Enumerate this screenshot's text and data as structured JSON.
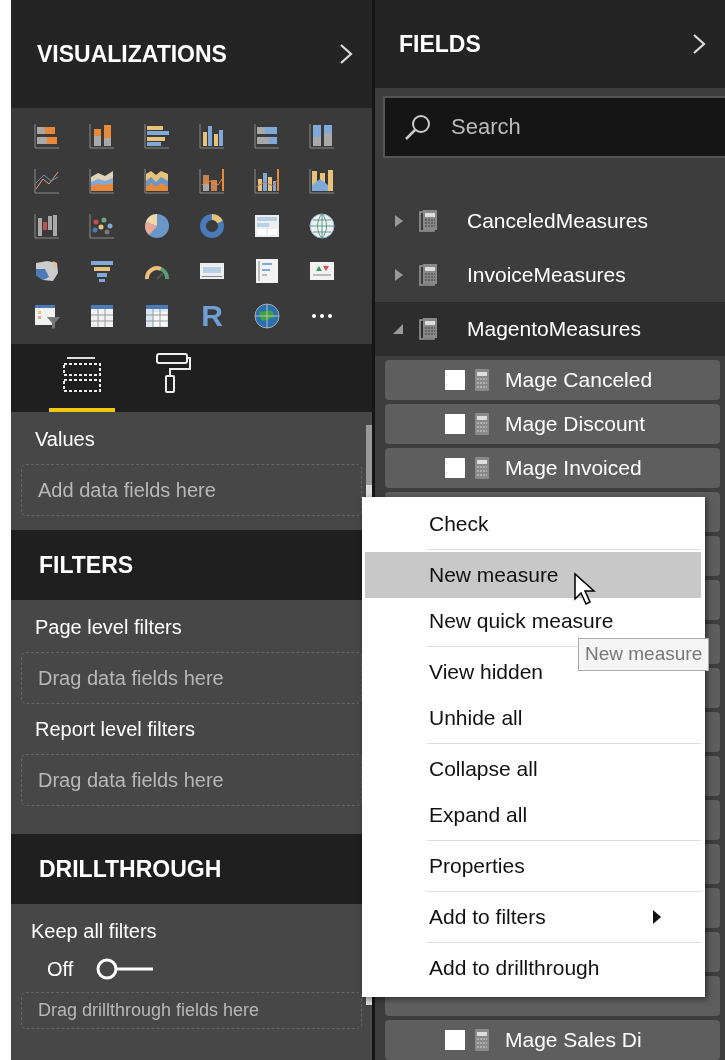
{
  "visualizations": {
    "title": "VISUALIZATIONS",
    "r_label": "R",
    "tabs": [
      {
        "kind": "fields",
        "selected": true
      },
      {
        "kind": "format",
        "selected": false
      }
    ],
    "values": {
      "label": "Values",
      "placeholder": "Add data fields here"
    }
  },
  "filters": {
    "title": "FILTERS",
    "sections": [
      {
        "label": "Page level filters",
        "placeholder": "Drag data fields here"
      },
      {
        "label": "Report level filters",
        "placeholder": "Drag data fields here"
      }
    ]
  },
  "drillthrough": {
    "title": "DRILLTHROUGH",
    "toggle_label": "Keep all filters",
    "toggle_state": "Off",
    "on": false,
    "placeholder": "Drag drillthrough fields here"
  },
  "fields": {
    "title": "FIELDS",
    "search": {
      "placeholder": "Search"
    },
    "tables": [
      {
        "name": "CanceledMeasures",
        "expanded": false
      },
      {
        "name": "InvoiceMeasures",
        "expanded": false
      },
      {
        "name": "MagentoMeasures",
        "expanded": true,
        "children": [
          {
            "name": "Mage Canceled",
            "checked": false
          },
          {
            "name": "Mage Discount",
            "checked": false
          },
          {
            "name": "Mage Invoiced",
            "checked": false
          },
          {
            "name": "Mage Sales Di",
            "checked": false
          }
        ]
      }
    ]
  },
  "context_menu": {
    "groups": [
      [
        {
          "label": "Check",
          "selected": false,
          "submenu": false
        }
      ],
      [
        {
          "label": "New measure",
          "selected": true,
          "submenu": false
        },
        {
          "label": "New quick measure",
          "selected": false,
          "submenu": false
        }
      ],
      [
        {
          "label": "View hidden",
          "selected": false,
          "submenu": false
        },
        {
          "label": "Unhide all",
          "selected": false,
          "submenu": false
        }
      ],
      [
        {
          "label": "Collapse all",
          "selected": false,
          "submenu": false
        },
        {
          "label": "Expand all",
          "selected": false,
          "submenu": false
        }
      ],
      [
        {
          "label": "Properties",
          "selected": false,
          "submenu": false
        }
      ],
      [
        {
          "label": "Add to filters",
          "selected": false,
          "submenu": true
        }
      ],
      [
        {
          "label": "Add to drillthrough",
          "selected": false,
          "submenu": false
        }
      ]
    ]
  },
  "tooltip": "New measure"
}
